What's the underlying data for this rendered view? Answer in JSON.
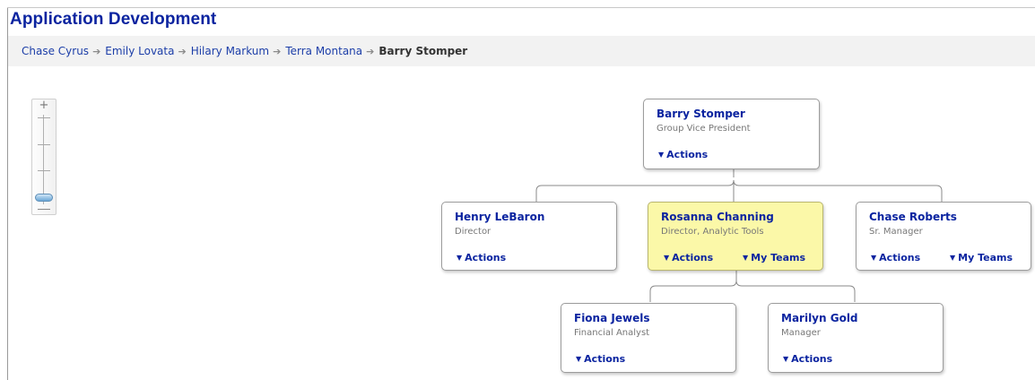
{
  "page": {
    "title": "Application Development"
  },
  "breadcrumb": {
    "links": [
      "Chase Cyrus",
      "Emily Lovata",
      "Hilary Markum",
      "Terra Montana"
    ],
    "separator": "➔",
    "current": "Barry Stomper"
  },
  "zoom_control": {
    "plus": "+",
    "level": 0.0
  },
  "org_chart": {
    "root": {
      "name": "Barry Stomper",
      "title": "Group Vice President",
      "actions": "Actions"
    },
    "reports": [
      {
        "name": "Henry LeBaron",
        "title": "Director",
        "actions": "Actions"
      },
      {
        "name": "Rosanna Channing",
        "title": "Director, Analytic Tools",
        "actions": "Actions",
        "teams": "My Teams",
        "highlighted": true
      },
      {
        "name": "Chase Roberts",
        "title": "Sr. Manager",
        "actions": "Actions",
        "teams": "My Teams"
      }
    ],
    "sub_reports": [
      {
        "name": "Fiona Jewels",
        "title": "Financial Analyst",
        "actions": "Actions"
      },
      {
        "name": "Marilyn Gold",
        "title": "Manager",
        "actions": "Actions"
      }
    ]
  },
  "colors": {
    "link": "#0b24a0",
    "highlight": "#fbf8a8",
    "breadcrumb_bg": "#f2f2f2"
  }
}
